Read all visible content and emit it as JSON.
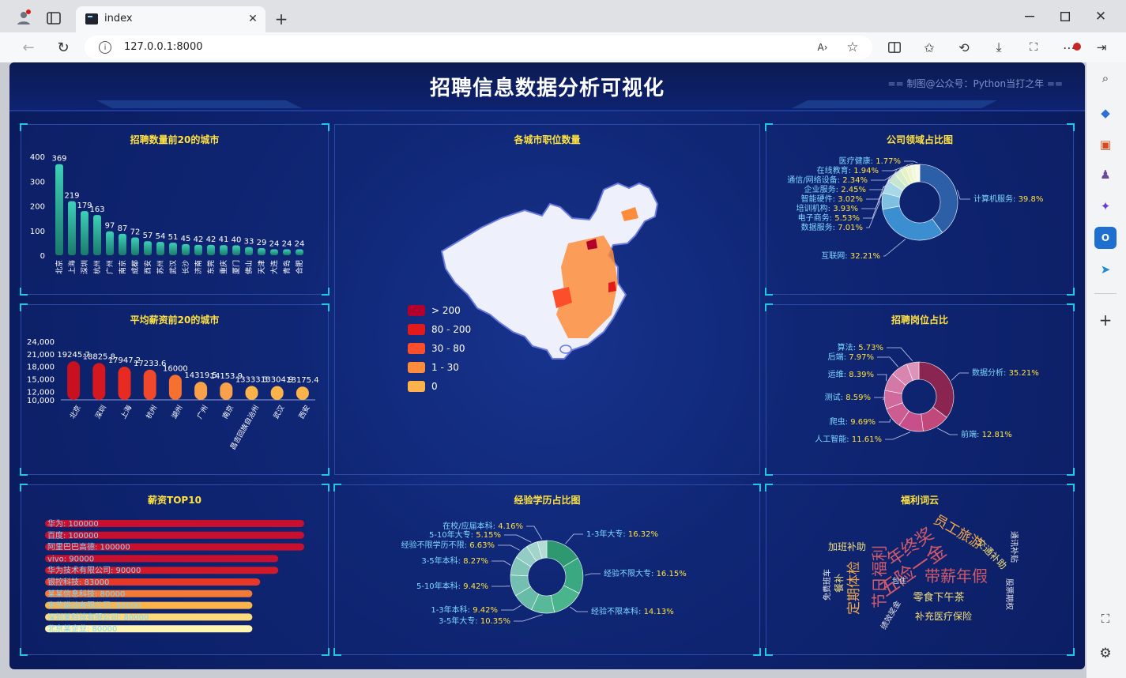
{
  "browser": {
    "tab_title": "index",
    "url": "127.0.0.1:8000"
  },
  "dashboard": {
    "title": "招聘信息数据分析可视化",
    "credit": "== 制图@公众号：Python当打之年 =="
  },
  "panels": {
    "top_cities": {
      "title": "招聘数量前20的城市",
      "yticks": [
        "400",
        "300",
        "200",
        "100",
        "0"
      ],
      "bar_color_top": "#3fd0b8",
      "bar_color_bottom": "#1a7a6a"
    },
    "salary_cities": {
      "title": "平均薪资前20的城市",
      "yticks": [
        "24,000",
        "21,000",
        "18,000",
        "15,000",
        "12,000",
        "10,000"
      ]
    },
    "map": {
      "title": "各城市职位数量",
      "legend": [
        {
          "label": "> 200",
          "color": "#b3002d"
        },
        {
          "label": "80 - 200",
          "color": "#e31a1c"
        },
        {
          "label": "30 - 80",
          "color": "#fc4e2a"
        },
        {
          "label": "1 - 30",
          "color": "#fd8d3c"
        },
        {
          "label": "0",
          "color": "#feb24c"
        }
      ]
    },
    "company_domain": {
      "title": "公司领域占比图"
    },
    "job_share": {
      "title": "招聘岗位占比"
    },
    "salary_top10": {
      "title": "薪资TOP10"
    },
    "edu_exp": {
      "title": "经验学历占比图"
    },
    "welfare": {
      "title": "福利词云"
    }
  },
  "chart_data": [
    {
      "type": "bar",
      "title": "招聘数量前20的城市",
      "categories": [
        "北京",
        "上海",
        "深圳",
        "杭州",
        "广州",
        "南京",
        "成都",
        "西安",
        "苏州",
        "武汉",
        "长沙",
        "济南",
        "东莞",
        "重庆",
        "厦门",
        "佛山",
        "天津",
        "大连",
        "青岛",
        "合肥"
      ],
      "values": [
        369,
        219,
        179,
        163,
        97,
        87,
        72,
        57,
        54,
        51,
        45,
        42,
        42,
        41,
        40,
        33,
        29,
        24,
        24,
        24
      ],
      "ylim": [
        0,
        400
      ]
    },
    {
      "type": "bar",
      "title": "平均薪资前20的城市",
      "categories": [
        "北京",
        "深圳",
        "上海",
        "杭州",
        "湖州",
        "广州",
        "南京",
        "昌吉回族自治州",
        "武汉",
        "西安"
      ],
      "values": [
        19245.7,
        18825.8,
        17947.2,
        17233.6,
        16000,
        14319.5,
        14153.9,
        13333.3,
        13304.9,
        13175.4
      ],
      "value_labels": [
        "19245.7",
        "18825.8",
        "17947.2",
        "17233.6",
        "16000",
        "14319.5",
        "14153.9",
        "13333.3",
        "13304.9",
        "13175.4"
      ],
      "colors": [
        "#c8101f",
        "#d5181f",
        "#e82a20",
        "#f0482a",
        "#f6702f",
        "#f9a04a",
        "#f9a04a",
        "#fbb34a",
        "#fbb34a",
        "#fbb34a"
      ],
      "ylim": [
        10000,
        24000
      ]
    },
    {
      "type": "pie",
      "title": "公司领域占比图",
      "labels": [
        "计算机服务",
        "互联网",
        "数据服务",
        "电子商务",
        "培训机构",
        "智能硬件",
        "企业服务",
        "通信/网络设备",
        "在线教育",
        "医疗健康"
      ],
      "values": [
        39.8,
        32.21,
        7.01,
        5.53,
        3.93,
        3.02,
        2.45,
        2.34,
        1.94,
        1.77
      ],
      "value_labels": [
        "39.8%",
        "32.21%",
        "7.01%",
        "5.53%",
        "3.93%",
        "3.02%",
        "2.45%",
        "2.34%",
        "1.94%",
        "1.77%"
      ],
      "colors": [
        "#2d5ea8",
        "#3b8fd0",
        "#7fbfe0",
        "#a8d8e8",
        "#c6e6d0",
        "#d8eec8",
        "#e6f2c4",
        "#eef6d0",
        "#f2f8dc",
        "#f6fae6"
      ]
    },
    {
      "type": "pie",
      "title": "招聘岗位占比",
      "labels": [
        "数据分析",
        "前端",
        "人工智能",
        "爬虫",
        "测试",
        "运维",
        "后端",
        "算法"
      ],
      "values": [
        35.21,
        12.81,
        11.61,
        9.69,
        8.59,
        8.39,
        7.97,
        5.73
      ],
      "value_labels": [
        "35.21%",
        "12.81%",
        "11.61%",
        "9.69%",
        "8.59%",
        "8.39%",
        "7.97%",
        "5.73%"
      ],
      "colors": [
        "#8a2450",
        "#c0487a",
        "#c8508a",
        "#cc5c92",
        "#d06a9c",
        "#d478a6",
        "#d886b0",
        "#dc94ba"
      ]
    },
    {
      "type": "bar",
      "title": "薪资TOP10",
      "labels": [
        "华为: 100000",
        "百度: 100000",
        "阿里巴巴高德: 100000",
        "vivo: 90000",
        "华为技术有限公司: 90000",
        "银控科技: 83000",
        "某某信息科技: 80000",
        "字节跳动有限公司: 80000",
        "深圳某科技有限公司: 80000",
        "北京某企业: 80000"
      ],
      "values": [
        100000,
        100000,
        100000,
        90000,
        90000,
        83000,
        80000,
        80000,
        80000,
        80000
      ],
      "colors": [
        "#c8102e",
        "#c8102e",
        "#c8102e",
        "#c8102e",
        "#d01a2a",
        "#e53828",
        "#f47a36",
        "#fbb34a",
        "#fdd97a",
        "#fff5b0"
      ],
      "xlim": [
        0,
        100000
      ]
    },
    {
      "type": "pie",
      "title": "经验学历占比图",
      "labels": [
        "1-3年大专",
        "经验不限大专",
        "经验不限本科",
        "3-5年大专",
        "1-3年本科",
        "5-10年本科",
        "3-5年本科",
        "经验不限学历不限",
        "5-10年大专",
        "在校/应届本科"
      ],
      "values": [
        16.32,
        16.15,
        14.13,
        10.35,
        9.42,
        9.42,
        8.27,
        6.63,
        5.15,
        4.16
      ],
      "value_labels": [
        "16.32%",
        "16.15%",
        "14.13%",
        "10.35%",
        "9.42%",
        "9.42%",
        "8.27%",
        "6.63%",
        "5.15%",
        "4.16%"
      ],
      "colors": [
        "#2e9870",
        "#3aa880",
        "#4ab48c",
        "#58b89a",
        "#66bca6",
        "#74c0b0",
        "#82c6ba",
        "#92ccc4",
        "#a2d4cc",
        "#b4dcd6"
      ]
    },
    {
      "type": "table",
      "title": "福利词云",
      "words": [
        {
          "text": "年终奖",
          "color": "#d05a6a",
          "size": 22
        },
        {
          "text": "五险一金",
          "color": "#d05a6a",
          "size": 24
        },
        {
          "text": "节日福利",
          "color": "#d05a6a",
          "size": 20
        },
        {
          "text": "带薪年假",
          "color": "#d05a6a",
          "size": 20
        },
        {
          "text": "员工旅游",
          "color": "#f4a94a",
          "size": 17
        },
        {
          "text": "定期体检",
          "color": "#f4a94a",
          "size": 17
        },
        {
          "text": "零食下午茶",
          "color": "#f4e07a",
          "size": 13
        },
        {
          "text": "补充医疗保险",
          "color": "#f4e07a",
          "size": 12
        },
        {
          "text": "加班补助",
          "color": "#f4e07a",
          "size": 12
        },
        {
          "text": "交通补助",
          "color": "#f4e07a",
          "size": 12
        },
        {
          "text": "通讯补贴",
          "color": "#e8e8e8",
          "size": 10
        },
        {
          "text": "股票期权",
          "color": "#e8e8e8",
          "size": 10
        },
        {
          "text": "餐补",
          "color": "#f4e07a",
          "size": 12
        },
        {
          "text": "绩效奖金",
          "color": "#e8e8e8",
          "size": 10
        },
        {
          "text": "免费班车",
          "color": "#e8e8e8",
          "size": 10
        },
        {
          "text": "包住",
          "color": "#e8e8e8",
          "size": 9
        }
      ]
    }
  ]
}
